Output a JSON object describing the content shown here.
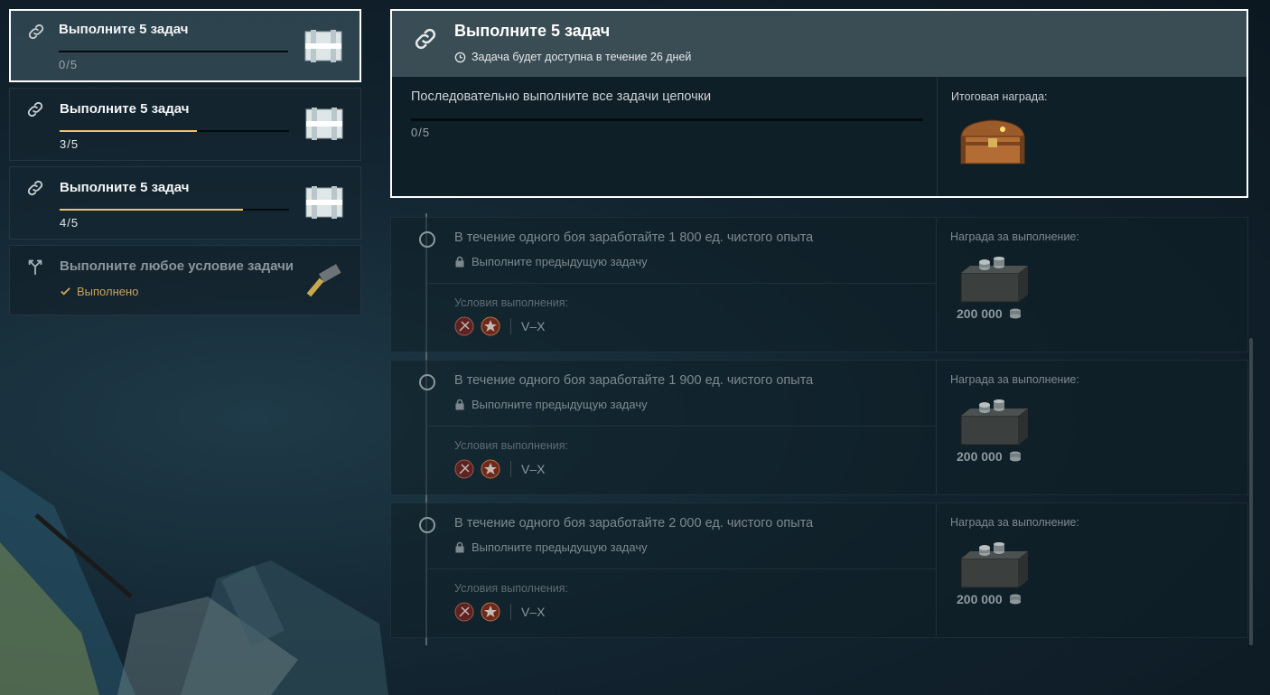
{
  "tasks": [
    {
      "title": "Выполните 5 задач",
      "count": "0/5",
      "progress": 0.0,
      "icon": "chain-link-icon",
      "reward_icon": "steel-container-icon",
      "state": "active"
    },
    {
      "title": "Выполните 5 задач",
      "count": "3/5",
      "progress": 0.6,
      "icon": "chain-link-icon",
      "reward_icon": "steel-container-icon",
      "state": "normal"
    },
    {
      "title": "Выполните 5 задач",
      "count": "4/5",
      "progress": 0.8,
      "icon": "chain-link-icon",
      "reward_icon": "steel-container-icon",
      "state": "normal"
    },
    {
      "title": "Выполните любое условие задачи",
      "status": "Выполнено",
      "icon": "branch-fork-icon",
      "reward_icon": "hammer-icon",
      "state": "completed"
    }
  ],
  "detail": {
    "title": "Выполните 5 задач",
    "availability": "Задача будет доступна в течение 26 дней",
    "description": "Последовательно выполните все задачи цепочки",
    "count": "0/5",
    "progress": 0.0,
    "final_reward_label": "Итоговая награда:"
  },
  "subtasks": [
    {
      "title": "В течение одного боя заработайте 1 800 ед. чистого опыта",
      "lock_text": "Выполните предыдущую задачу",
      "conditions_label": "Условия выполнения:",
      "tier": "V–X",
      "reward_label": "Награда за выполнение:",
      "reward_amount": "200 000"
    },
    {
      "title": "В течение одного боя заработайте 1 900 ед. чистого опыта",
      "lock_text": "Выполните предыдущую задачу",
      "conditions_label": "Условия выполнения:",
      "tier": "V–X",
      "reward_label": "Награда за выполнение:",
      "reward_amount": "200 000"
    },
    {
      "title": "В течение одного боя заработайте 2 000 ед. чистого опыта",
      "lock_text": "Выполните предыдущую задачу",
      "conditions_label": "Условия выполнения:",
      "tier": "V–X",
      "reward_label": "Награда за выполнение:",
      "reward_amount": "200 000"
    }
  ],
  "colors": {
    "progress_fill": "#e9c565",
    "completed_text": "#c8a35a",
    "header_bg": "#3b4d54"
  }
}
